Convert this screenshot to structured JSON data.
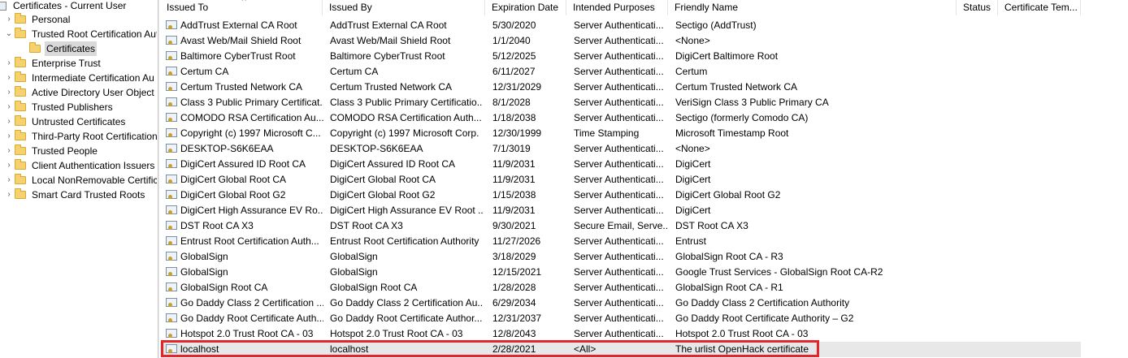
{
  "tree": {
    "root": "Certificates - Current User",
    "items": [
      {
        "label": "Personal",
        "expander": "›"
      },
      {
        "label": "Trusted Root Certification Aut",
        "expander": "⌄"
      },
      {
        "label": "Certificates",
        "expander": "",
        "selected": true
      },
      {
        "label": "Enterprise Trust",
        "expander": "›"
      },
      {
        "label": "Intermediate Certification Au",
        "expander": "›"
      },
      {
        "label": "Active Directory User Object",
        "expander": "›"
      },
      {
        "label": "Trusted Publishers",
        "expander": "›"
      },
      {
        "label": "Untrusted Certificates",
        "expander": "›"
      },
      {
        "label": "Third-Party Root Certification",
        "expander": "›"
      },
      {
        "label": "Trusted People",
        "expander": "›"
      },
      {
        "label": "Client Authentication Issuers",
        "expander": "›"
      },
      {
        "label": "Local NonRemovable Certific",
        "expander": "›"
      },
      {
        "label": "Smart Card Trusted Roots",
        "expander": "›"
      }
    ]
  },
  "close_glyph": "×",
  "columns": [
    "Issued To",
    "Issued By",
    "Expiration Date",
    "Intended Purposes",
    "Friendly Name",
    "Status",
    "Certificate Tem..."
  ],
  "rows": [
    [
      "AddTrust External CA Root",
      "AddTrust External CA Root",
      "5/30/2020",
      "Server Authenticati...",
      "Sectigo (AddTrust)"
    ],
    [
      "Avast Web/Mail Shield Root",
      "Avast Web/Mail Shield Root",
      "1/1/2040",
      "Server Authenticati...",
      "<None>"
    ],
    [
      "Baltimore CyberTrust Root",
      "Baltimore CyberTrust Root",
      "5/12/2025",
      "Server Authenticati...",
      "DigiCert Baltimore Root"
    ],
    [
      "Certum CA",
      "Certum CA",
      "6/11/2027",
      "Server Authenticati...",
      "Certum"
    ],
    [
      "Certum Trusted Network CA",
      "Certum Trusted Network CA",
      "12/31/2029",
      "Server Authenticati...",
      "Certum Trusted Network CA"
    ],
    [
      "Class 3 Public Primary Certificat...",
      "Class 3 Public Primary Certificatio...",
      "8/1/2028",
      "Server Authenticati...",
      "VeriSign Class 3 Public Primary CA"
    ],
    [
      "COMODO RSA Certification Au...",
      "COMODO RSA Certification Auth...",
      "1/18/2038",
      "Server Authenticati...",
      "Sectigo (formerly Comodo CA)"
    ],
    [
      "Copyright (c) 1997 Microsoft C...",
      "Copyright (c) 1997 Microsoft Corp.",
      "12/30/1999",
      "Time Stamping",
      "Microsoft Timestamp Root"
    ],
    [
      "DESKTOP-S6K6EAA",
      "DESKTOP-S6K6EAA",
      "7/1/3019",
      "Server Authenticati...",
      "<None>"
    ],
    [
      "DigiCert Assured ID Root CA",
      "DigiCert Assured ID Root CA",
      "11/9/2031",
      "Server Authenticati...",
      "DigiCert"
    ],
    [
      "DigiCert Global Root CA",
      "DigiCert Global Root CA",
      "11/9/2031",
      "Server Authenticati...",
      "DigiCert"
    ],
    [
      "DigiCert Global Root G2",
      "DigiCert Global Root G2",
      "1/15/2038",
      "Server Authenticati...",
      "DigiCert Global Root G2"
    ],
    [
      "DigiCert High Assurance EV Ro...",
      "DigiCert High Assurance EV Root ...",
      "11/9/2031",
      "Server Authenticati...",
      "DigiCert"
    ],
    [
      "DST Root CA X3",
      "DST Root CA X3",
      "9/30/2021",
      "Secure Email, Serve...",
      "DST Root CA X3"
    ],
    [
      "Entrust Root Certification Auth...",
      "Entrust Root Certification Authority",
      "11/27/2026",
      "Server Authenticati...",
      "Entrust"
    ],
    [
      "GlobalSign",
      "GlobalSign",
      "3/18/2029",
      "Server Authenticati...",
      "GlobalSign Root CA - R3"
    ],
    [
      "GlobalSign",
      "GlobalSign",
      "12/15/2021",
      "Server Authenticati...",
      "Google Trust Services - GlobalSign Root CA-R2"
    ],
    [
      "GlobalSign Root CA",
      "GlobalSign Root CA",
      "1/28/2028",
      "Server Authenticati...",
      "GlobalSign Root CA - R1"
    ],
    [
      "Go Daddy Class 2 Certification ...",
      "Go Daddy Class 2 Certification Au...",
      "6/29/2034",
      "Server Authenticati...",
      "Go Daddy Class 2 Certification Authority"
    ],
    [
      "Go Daddy Root Certificate Auth...",
      "Go Daddy Root Certificate Author...",
      "12/31/2037",
      "Server Authenticati...",
      "Go Daddy Root Certificate Authority – G2"
    ],
    [
      "Hotspot 2.0 Trust Root CA - 03",
      "Hotspot 2.0 Trust Root CA - 03",
      "12/8/2043",
      "Server Authenticati...",
      "Hotspot 2.0 Trust Root CA - 03"
    ],
    [
      "localhost",
      "localhost",
      "2/28/2021",
      "<All>",
      "The urlist OpenHack certificate"
    ]
  ],
  "highlight_color": "#e3262b"
}
